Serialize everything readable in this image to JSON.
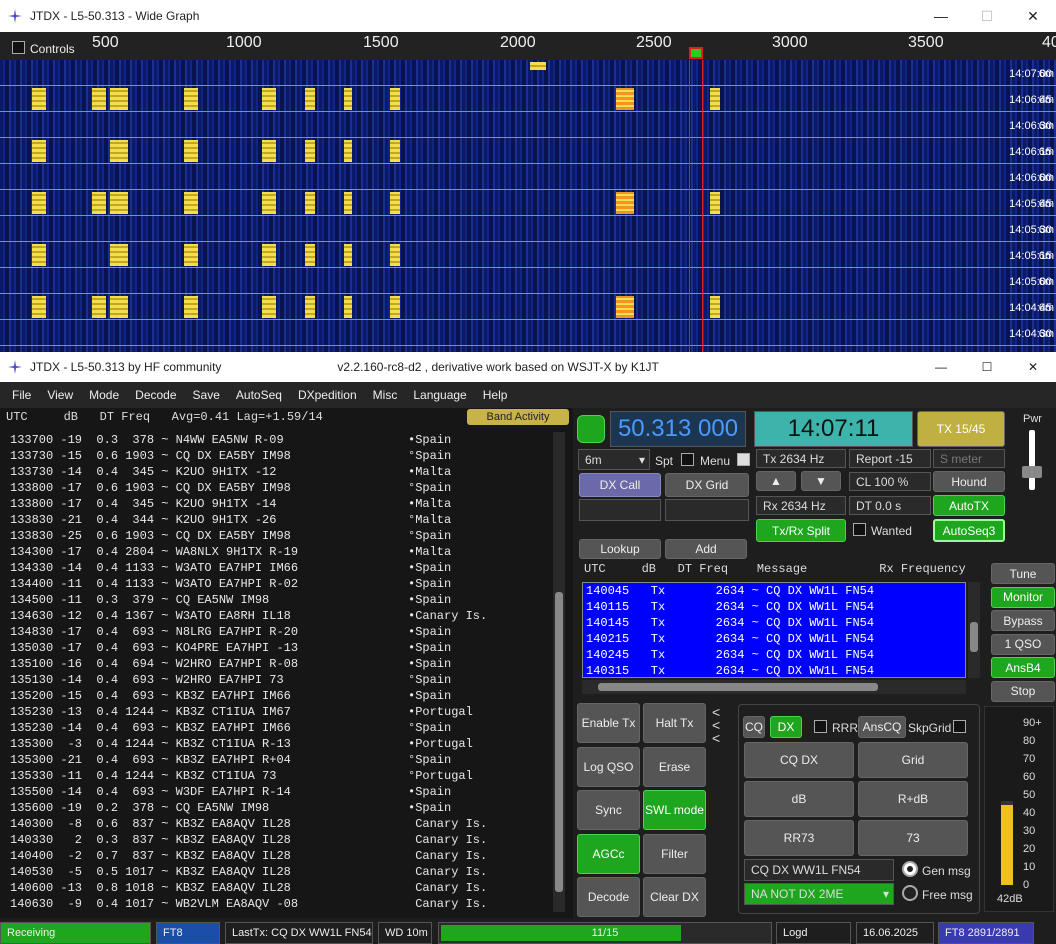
{
  "wide": {
    "title": "JTDX - L5-50.313 - Wide Graph",
    "controls": "Controls",
    "scale": [
      "500",
      "1000",
      "1500",
      "2000",
      "2500",
      "3000",
      "3500",
      "40"
    ],
    "times": [
      "14:07:00",
      "14:06:45",
      "14:06:30",
      "14:06:15",
      "14:06:00",
      "14:05:45",
      "14:05:30",
      "14:05:15",
      "14:05:00",
      "14:04:45",
      "14:04:30"
    ],
    "band": "6m"
  },
  "main": {
    "title": "JTDX - L5-50.313  by HF community",
    "subtitle": "v2.2.160-rc8-d2 , derivative work based on WSJT-X by K1JT",
    "menu": [
      "File",
      "View",
      "Mode",
      "Decode",
      "Save",
      "AutoSeq",
      "DXpedition",
      "Misc",
      "Language",
      "Help"
    ],
    "head": "UTC     dB   DT Freq   Avg=0.41 Lag=+1.59/14",
    "band_activity": "Band Activity",
    "rows": [
      [
        "133700 -19  0.3  378 ~ N4WW EA5NW R-09",
        "•Spain"
      ],
      [
        "133730 -15  0.6 1903 ~ CQ DX EA5BY IM98",
        "°Spain"
      ],
      [
        "133730 -14  0.4  345 ~ K2UO 9H1TX -12",
        "•Malta"
      ],
      [
        "133800 -17  0.6 1903 ~ CQ DX EA5BY IM98",
        "°Spain"
      ],
      [
        "133800 -17  0.4  345 ~ K2UO 9H1TX -14",
        "•Malta"
      ],
      [
        "133830 -21  0.4  344 ~ K2UO 9H1TX -26",
        "°Malta"
      ],
      [
        "133830 -25  0.6 1903 ~ CQ DX EA5BY IM98",
        "°Spain"
      ],
      [
        "134300 -17  0.4 2804 ~ WA8NLX 9H1TX R-19",
        "•Malta"
      ],
      [
        "134330 -14  0.4 1133 ~ W3ATO EA7HPI IM66",
        "•Spain"
      ],
      [
        "134400 -11  0.4 1133 ~ W3ATO EA7HPI R-02",
        "•Spain"
      ],
      [
        "134500 -11  0.3  379 ~ CQ EA5NW IM98",
        "•Spain"
      ],
      [
        "134630 -12  0.4 1367 ~ W3ATO EA8RH IL18",
        "•Canary Is."
      ],
      [
        "134830 -17  0.4  693 ~ N8LRG EA7HPI R-20",
        "•Spain"
      ],
      [
        "135030 -17  0.4  693 ~ KO4PRE EA7HPI -13",
        "•Spain"
      ],
      [
        "135100 -16  0.4  694 ~ W2HRO EA7HPI R-08",
        "•Spain"
      ],
      [
        "135130 -14  0.4  693 ~ W2HRO EA7HPI 73",
        "°Spain"
      ],
      [
        "135200 -15  0.4  693 ~ KB3Z EA7HPI IM66",
        "•Spain"
      ],
      [
        "135230 -13  0.4 1244 ~ KB3Z CT1IUA IM67",
        "•Portugal"
      ],
      [
        "135230 -14  0.4  693 ~ KB3Z EA7HPI IM66",
        "°Spain"
      ],
      [
        "135300  -3  0.4 1244 ~ KB3Z CT1IUA R-13",
        "•Portugal"
      ],
      [
        "135300 -21  0.4  693 ~ KB3Z EA7HPI R+04",
        "°Spain"
      ],
      [
        "135330 -11  0.4 1244 ~ KB3Z CT1IUA 73",
        "°Portugal"
      ],
      [
        "135500 -14  0.4  693 ~ W3DF EA7HPI R-14",
        "•Spain"
      ],
      [
        "135600 -19  0.2  378 ~ CQ EA5NW IM98",
        "•Spain"
      ],
      [
        "140300  -8  0.6  837 ~ KB3Z EA8AQV IL28",
        " Canary Is."
      ],
      [
        "140330   2  0.3  837 ~ KB3Z EA8AQV IL28",
        " Canary Is."
      ],
      [
        "140400  -2  0.7  837 ~ KB3Z EA8AQV IL28",
        " Canary Is."
      ],
      [
        "140530  -5  0.5 1017 ~ KB3Z EA8AQV IL28",
        " Canary Is."
      ],
      [
        "140600 -13  0.8 1018 ~ KB3Z EA8AQV IL28",
        " Canary Is."
      ],
      [
        "140630  -9  0.4 1017 ~ WB2VLM EA8AQV -08",
        " Canary Is."
      ]
    ],
    "freq": "50.313 000",
    "time": "14:07:11",
    "tx_period": "TX 15/45",
    "pwr": "Pwr",
    "band_sel": "6m",
    "spt": "Spt",
    "menu_lbl": "Menu",
    "tx_hz": "Tx  2634 Hz",
    "report": "Report -15",
    "smeter": "S meter",
    "dxcall": "DX Call",
    "dxgrid": "DX Grid",
    "rx_hz": "Rx  2634 Hz",
    "cl": "CL  100 %",
    "hound": "Hound",
    "dt": "DT 0.0 s",
    "autotx": "AutoTX",
    "split": "Tx/Rx Split",
    "wanted": "Wanted",
    "autoseq": "AutoSeq3",
    "lookup": "Lookup",
    "add": "Add",
    "txhead": "UTC     dB   DT Freq    Message          Rx Frequency",
    "txrows": [
      "140045   Tx       2634 ~ CQ DX WW1L FN54",
      "140115   Tx       2634 ~ CQ DX WW1L FN54",
      "140145   Tx       2634 ~ CQ DX WW1L FN54",
      "140215   Tx       2634 ~ CQ DX WW1L FN54",
      "140245   Tx       2634 ~ CQ DX WW1L FN54",
      "140315   Tx       2634 ~ CQ DX WW1L FN54"
    ],
    "right": [
      "Tune",
      "Monitor",
      "Bypass",
      "1 QSO",
      "AnsB4",
      "Stop"
    ],
    "leftbtns": [
      "Enable Tx",
      "Halt Tx",
      "Log QSO",
      "Erase",
      "Sync",
      "SWL mode",
      "AGCc",
      "Filter",
      "Decode",
      "Clear DX"
    ],
    "cq": "CQ",
    "dx": "DX",
    "rrr": "RRR",
    "anscq": "AnsCQ",
    "skpgrid": "SkpGrid",
    "gen": [
      "CQ DX",
      "Grid",
      "dB",
      "R+dB",
      "RR73",
      "73"
    ],
    "genmsg": "CQ DX WW1L FN54",
    "genlbl": "Gen msg",
    "filter": "NA NOT DX 2ME",
    "freelbl": "Free msg",
    "meter_scale": [
      "90+",
      "80",
      "70",
      "60",
      "50",
      "40",
      "30",
      "20",
      "10",
      "0"
    ],
    "meter_val": "42dB",
    "status": {
      "state": "Receiving",
      "mode": "FT8",
      "lasttx": "LastTx: CQ DX WW1L FN54",
      "wd": "WD 10m",
      "progress": "11/15",
      "logd": "Logd",
      "date": "16.06.2025",
      "decodes": "FT8  2891/2891"
    }
  }
}
